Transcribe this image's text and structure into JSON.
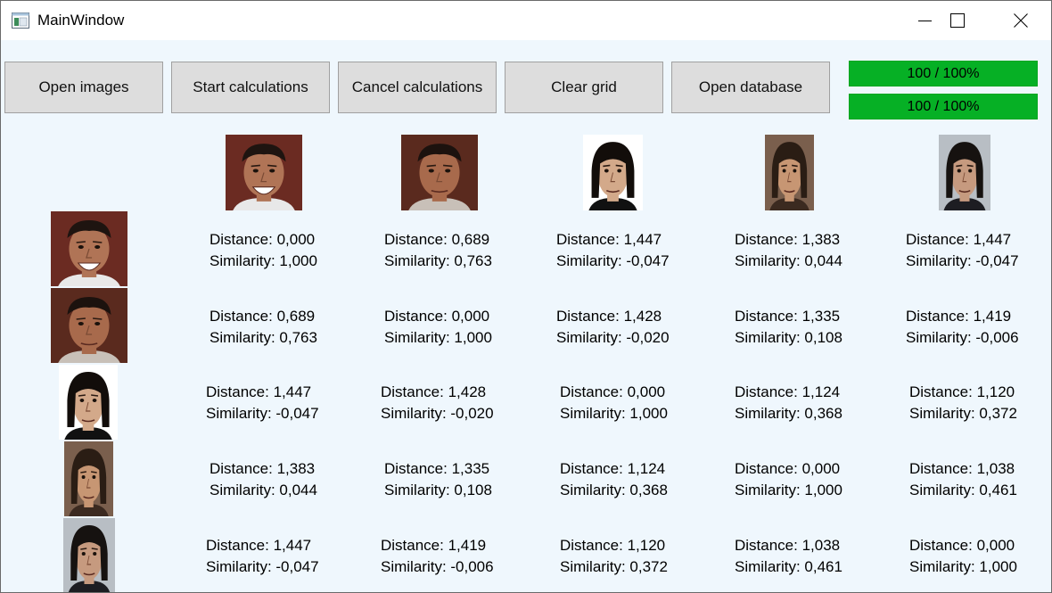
{
  "window": {
    "title": "MainWindow"
  },
  "toolbar": {
    "buttons": [
      "Open images",
      "Start calculations",
      "Cancel calculations",
      "Clear grid",
      "Open database"
    ]
  },
  "progress": [
    {
      "value": 1.0,
      "text": "100 / 100%"
    },
    {
      "value": 1.0,
      "text": "100 / 100%"
    }
  ],
  "colors": {
    "progress": "#06b025",
    "background": "#eff7fd",
    "button": "#dddddd"
  },
  "grid": {
    "images": [
      "face-image",
      "face-image",
      "face-image",
      "face-image",
      "face-image"
    ],
    "distance_prefix": "Distance: ",
    "similarity_prefix": "Similarity: ",
    "rows": [
      [
        {
          "distance": "0,000",
          "similarity": "1,000"
        },
        {
          "distance": "0,689",
          "similarity": "0,763"
        },
        {
          "distance": "1,447",
          "similarity": "-0,047"
        },
        {
          "distance": "1,383",
          "similarity": "0,044"
        },
        {
          "distance": "1,447",
          "similarity": "-0,047"
        }
      ],
      [
        {
          "distance": "0,689",
          "similarity": "0,763"
        },
        {
          "distance": "0,000",
          "similarity": "1,000"
        },
        {
          "distance": "1,428",
          "similarity": "-0,020"
        },
        {
          "distance": "1,335",
          "similarity": "0,108"
        },
        {
          "distance": "1,419",
          "similarity": "-0,006"
        }
      ],
      [
        {
          "distance": "1,447",
          "similarity": "-0,047"
        },
        {
          "distance": "1,428",
          "similarity": "-0,020"
        },
        {
          "distance": "0,000",
          "similarity": "1,000"
        },
        {
          "distance": "1,124",
          "similarity": "0,368"
        },
        {
          "distance": "1,120",
          "similarity": "0,372"
        }
      ],
      [
        {
          "distance": "1,383",
          "similarity": "0,044"
        },
        {
          "distance": "1,335",
          "similarity": "0,108"
        },
        {
          "distance": "1,124",
          "similarity": "0,368"
        },
        {
          "distance": "0,000",
          "similarity": "1,000"
        },
        {
          "distance": "1,038",
          "similarity": "0,461"
        }
      ],
      [
        {
          "distance": "1,447",
          "similarity": "-0,047"
        },
        {
          "distance": "1,419",
          "similarity": "-0,006"
        },
        {
          "distance": "1,120",
          "similarity": "0,372"
        },
        {
          "distance": "1,038",
          "similarity": "0,461"
        },
        {
          "distance": "0,000",
          "similarity": "1,000"
        }
      ]
    ]
  }
}
